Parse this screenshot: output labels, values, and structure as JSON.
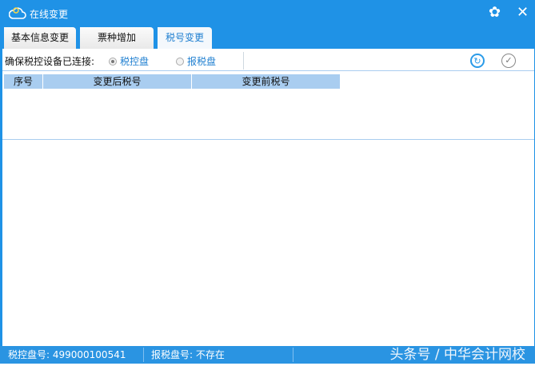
{
  "window": {
    "title": "在线变更",
    "settings_icon": "gear-icon",
    "close_icon": "close-icon"
  },
  "tabs": [
    {
      "label": "基本信息变更"
    },
    {
      "label": "票种增加"
    },
    {
      "label": "税号变更",
      "active": true
    }
  ],
  "toolbar": {
    "label": "确保税控设备已连接:",
    "options": [
      {
        "label": "税控盘",
        "selected": true
      },
      {
        "label": "报税盘",
        "selected": false
      }
    ]
  },
  "table": {
    "columns": [
      "序号",
      "变更后税号",
      "变更前税号"
    ],
    "rows": []
  },
  "status": {
    "tax_disk": "税控盘号: 499000100541",
    "report_disk": "报税盘号: 不存在"
  },
  "watermark": "头条号 / 中华会计网校",
  "colors": {
    "accent": "#1f92e6",
    "header": "#a9cdf0"
  }
}
